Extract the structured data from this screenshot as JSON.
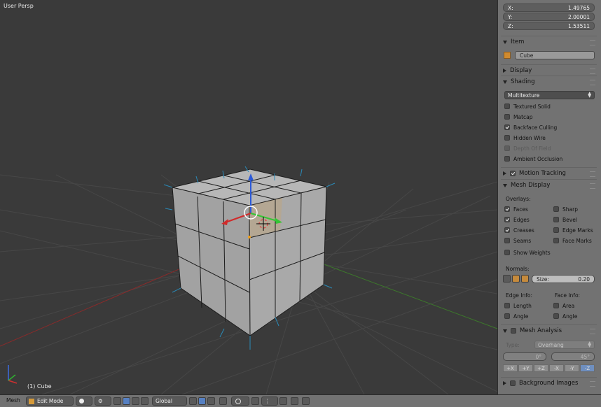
{
  "viewport": {
    "view_label": "User Persp",
    "object_label": "(1) Cube"
  },
  "sidebar": {
    "location": {
      "x_label": "X:",
      "x_value": "1.49765",
      "y_label": "Y:",
      "y_value": "2.00001",
      "z_label": "Z:",
      "z_value": "1.53511"
    },
    "item": {
      "header": "Item",
      "name": "Cube"
    },
    "display": {
      "header": "Display"
    },
    "shading": {
      "header": "Shading",
      "mode": "Multitexture",
      "options": [
        {
          "label": "Textured Solid",
          "checked": false
        },
        {
          "label": "Matcap",
          "checked": false
        },
        {
          "label": "Backface Culling",
          "checked": true
        },
        {
          "label": "Hidden Wire",
          "checked": false
        },
        {
          "label": "Depth Of Field",
          "checked": false,
          "disabled": true
        },
        {
          "label": "Ambient Occlusion",
          "checked": false
        }
      ]
    },
    "motion_tracking": {
      "header": "Motion Tracking",
      "checked": true
    },
    "mesh_display": {
      "header": "Mesh Display",
      "overlays_label": "Overlays:",
      "left": [
        {
          "label": "Faces",
          "checked": true
        },
        {
          "label": "Edges",
          "checked": true
        },
        {
          "label": "Creases",
          "checked": true
        },
        {
          "label": "Seams",
          "checked": false
        }
      ],
      "right": [
        {
          "label": "Sharp",
          "checked": false
        },
        {
          "label": "Bevel",
          "checked": false
        },
        {
          "label": "Edge Marks",
          "checked": false
        },
        {
          "label": "Face Marks",
          "checked": false
        }
      ],
      "show_weights": "Show Weights",
      "normals_label": "Normals:",
      "size_label": "Size:",
      "size_value": "0.20",
      "edge_info_label": "Edge Info:",
      "face_info_label": "Face Info:",
      "edge_info": [
        {
          "label": "Length"
        },
        {
          "label": "Angle"
        }
      ],
      "face_info": [
        {
          "label": "Area"
        },
        {
          "label": "Angle"
        }
      ]
    },
    "mesh_analysis": {
      "header": "Mesh Analysis",
      "type_label": "Type:",
      "type_value": "Overhang",
      "min_value": "0°",
      "max_value": "45°",
      "axes": [
        "+X",
        "+Y",
        "+Z",
        "-X",
        "-Y",
        "-Z"
      ]
    },
    "background_images": {
      "header": "Background Images"
    }
  },
  "statusbar": {
    "editor_label": "Mesh",
    "mode": "Edit Mode",
    "orientation": "Global"
  },
  "colors": {
    "viewport_bg": "#3a3a3a",
    "sidebar_bg": "#727272",
    "selected_blue": "#5680c2"
  }
}
